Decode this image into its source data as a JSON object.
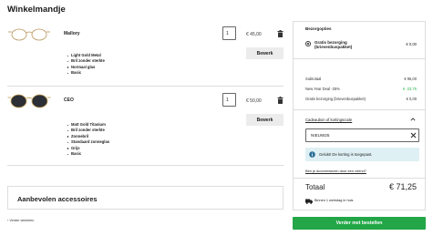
{
  "page": {
    "title": "Winkelmandje"
  },
  "cart": {
    "items": [
      {
        "name": "Mallory",
        "quantity": "1",
        "price": "€ 45,00",
        "edit_label": "Bewerk",
        "specs": [
          "Light Gold Metal",
          "Bril zonder sterkte",
          "Normaal glas",
          "Basic"
        ],
        "thumb_icon": "gold-wire-glasses-image"
      },
      {
        "name": "CEO",
        "quantity": "1",
        "price": "€ 50,00",
        "edit_label": "Bewerk",
        "specs": [
          "Matt Gold Titanium",
          "Bril zonder sterkte",
          "Zonnebril",
          "Standaard zonneglas",
          "Grijs",
          "Basic"
        ],
        "thumb_icon": "sunglasses-image"
      }
    ],
    "trash_icon": "trash-icon"
  },
  "recommended": {
    "title": "Aanbevolen accessoires"
  },
  "continue_link": "‹ Verder winkelen",
  "summary": {
    "shipping": {
      "title": "Bezorgopties",
      "option_label": "Gratis bezorging (brievenbuspakket)",
      "option_price": "€ 0,00"
    },
    "rows": [
      {
        "label": "Subtotaal",
        "value": "€ 95,00"
      },
      {
        "label": "New Year Deal -25%",
        "value": "€ -23,75"
      },
      {
        "label": "Gratis bezorging (brievenbuspakket)",
        "value": "€ 0,00"
      }
    ],
    "discount": {
      "toggle_label": "Cadeaubon of kortingscode",
      "code_value": "NIEUW25",
      "success_message": "Gelukt! De korting is toegepast.",
      "referral_link": "Ben je doorverwezen door een vriend?"
    },
    "total_label": "Totaal",
    "total_value": "€ 71,25",
    "delivery_note": "Binnen 1 werkdag in huis"
  },
  "checkout_label": "Verder met bestellen",
  "colors": {
    "accent_green": "#22a647",
    "discount_green": "#25b34a",
    "alert_bg": "#dff0f4"
  }
}
